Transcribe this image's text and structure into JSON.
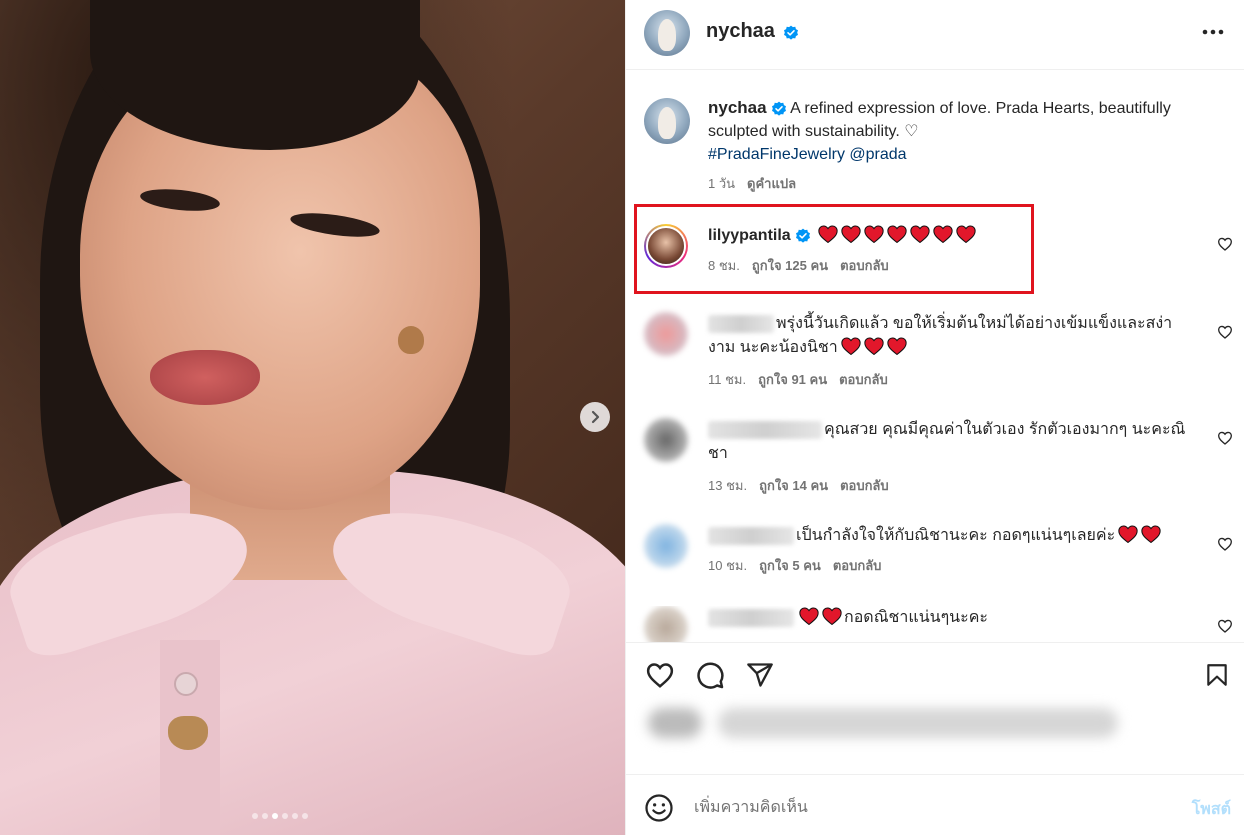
{
  "post": {
    "username": "nychaa",
    "more_icon": "more-horizontal-icon",
    "media": {
      "carousel_dots": 6,
      "active_dot": 2,
      "next_icon": "chevron-right-icon"
    }
  },
  "caption": {
    "username": "nychaa",
    "text": "A refined expression of love. Prada Hearts, beautifully sculpted with sustainability. ♡",
    "tags": "#PradaFineJewelry @prada",
    "time": "1 วัน",
    "translate": "ดูคำแปล"
  },
  "comments": [
    {
      "username": "lilyypantila",
      "verified": true,
      "text": "",
      "hearts": 7,
      "time": "8 ชม.",
      "likes": "ถูกใจ 125 คน",
      "reply": "ตอบกลับ",
      "highlighted": true
    },
    {
      "username": "",
      "text": "พรุ่งนี้วันเกิดแล้ว ขอให้เริ่มต้นใหม่ได้อย่างเข้มแข็งและสง่างาม นะคะน้องนิชา",
      "hearts": 3,
      "time": "11 ชม.",
      "likes": "ถูกใจ 91 คน",
      "reply": "ตอบกลับ"
    },
    {
      "username": "",
      "text": "คุณสวย คุณมีคุณค่าในตัวเอง รักตัวเองมากๆ นะคะณิชา",
      "hearts": 0,
      "time": "13 ชม.",
      "likes": "ถูกใจ 14 คน",
      "reply": "ตอบกลับ"
    },
    {
      "username": "",
      "text": "เป็นกำลังใจให้กับณิชานะคะ กอดๆแน่นๆเลยค่ะ",
      "hearts": 2,
      "time": "10 ชม.",
      "likes": "ถูกใจ 5 คน",
      "reply": "ตอบกลับ"
    },
    {
      "username": "",
      "text": "กอดณิชาแน่นๆนะคะ",
      "hearts": 2,
      "time": "",
      "likes": "",
      "reply": ""
    }
  ],
  "actions": {
    "like_icon": "heart-outline-icon",
    "comment_icon": "comment-bubble-icon",
    "share_icon": "paper-plane-icon",
    "save_icon": "bookmark-icon"
  },
  "add_comment": {
    "emoji_icon": "smiley-icon",
    "placeholder": "เพิ่มความคิดเห็น",
    "post_label": "โพสต์"
  },
  "colors": {
    "verified_blue": "#0095f6",
    "highlight_red": "#e0141e",
    "heart_red": "#e2172b",
    "hashtag_blue": "#00376b",
    "post_disabled": "#b2dffc"
  }
}
